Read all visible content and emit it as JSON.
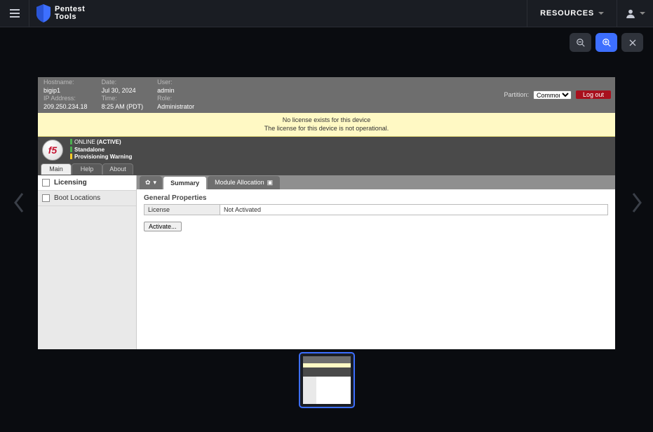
{
  "topbar": {
    "brand_line1": "Pentest",
    "brand_line2": "Tools",
    "resources_label": "RESOURCES"
  },
  "meta": {
    "hostname_label": "Hostname:",
    "hostname": "bigip1",
    "ip_label": "IP Address:",
    "ip": "209.250.234.18",
    "date_label": "Date:",
    "date": "Jul 30, 2024",
    "time_label": "Time:",
    "time": "8:25 AM (PDT)",
    "user_label": "User:",
    "user": "admin",
    "role_label": "Role:",
    "role": "Administrator",
    "partition_label": "Partition:",
    "partition_value": "Common",
    "logout": "Log out"
  },
  "notice": {
    "line1": "No license exists for this device",
    "line2": "The license for this device is not operational."
  },
  "status": {
    "l1_prefix": "ONLINE ",
    "l1_bold": "(ACTIVE)",
    "l2": "Standalone",
    "l3": "Provisioning Warning"
  },
  "tabs1": [
    "Main",
    "Help",
    "About"
  ],
  "sidebar": {
    "items": [
      {
        "label": "Licensing"
      },
      {
        "label": "Boot Locations"
      }
    ]
  },
  "tabs2": {
    "star_chev": "▾",
    "summary": "Summary",
    "module": "Module Allocation",
    "module_badge": "▣"
  },
  "content": {
    "section": "General Properties",
    "license_key": "License",
    "license_val": "Not Activated",
    "activate": "Activate..."
  }
}
